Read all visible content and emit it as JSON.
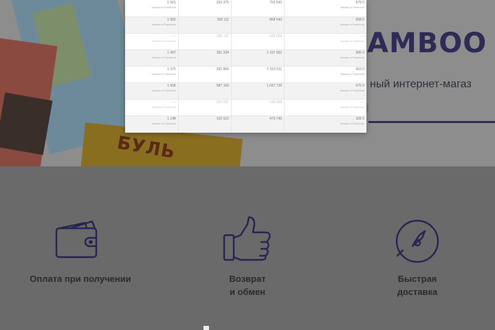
{
  "hero": {
    "brand": "AMBOO",
    "tagline": "ный интернет-магаз",
    "book_cover_text": "БУЛЬ"
  },
  "popup_table": {
    "rows": [
      {
        "c1": "1 561",
        "c1s": "Заказы в Facebook",
        "c2": "263 375",
        "c3": "753 642",
        "c4": "679 0",
        "c4s": "Заказы в Facebook",
        "faded": false
      },
      {
        "c1": "1 900",
        "c1s": "Заказы в Facebook",
        "c2": "358 111",
        "c3": "858 540",
        "c4": "658 0",
        "c4s": "Заказы в Facebook",
        "faded": false
      },
      {
        "c1": "—",
        "c1s": "Заказы в Facebook",
        "c2": "285 155",
        "c3": "588 056",
        "c4": "—",
        "c4s": "Заказы в Facebook",
        "faded": true
      },
      {
        "c1": "1 497",
        "c1s": "Заказы в Facebook",
        "c2": "391 234",
        "c3": "1 197 962",
        "c4": "589 0",
        "c4s": "Заказы в Facebook",
        "faded": false
      },
      {
        "c1": "1 375",
        "c1s": "Заказы в Facebook",
        "c2": "391 866",
        "c3": "1 019 511",
        "c4": "663 0",
        "c4s": "Заказы в Facebook",
        "faded": false
      },
      {
        "c1": "1 558",
        "c1s": "Заказы в Facebook",
        "c2": "587 160",
        "c3": "1 037 739",
        "c4": "675 0",
        "c4s": "Заказы в Facebook",
        "faded": false
      },
      {
        "c1": "—",
        "c1s": "Заказы в Facebook",
        "c2": "260 087",
        "c3": "548 088",
        "c4": "—",
        "c4s": "Заказы в Facebook",
        "faded": true
      },
      {
        "c1": "1 148",
        "c1s": "Заказы в Facebook",
        "c2": "192 022",
        "c3": "473 745",
        "c4": "328 0",
        "c4s": "Заказы в Facebook",
        "faded": false
      }
    ]
  },
  "features": [
    {
      "id": "payment",
      "label": "Оплата при получении",
      "icon": "wallet-icon"
    },
    {
      "id": "return",
      "label": "Возврат\nи обмен",
      "icon": "thumbs-up-icon"
    },
    {
      "id": "delivery",
      "label": "Быстрая\nдоставка",
      "icon": "compass-icon"
    }
  ],
  "colors": {
    "icon_stroke": "#262551",
    "brand": "#2e2c57",
    "overlay_bg": "#6a6a6a"
  }
}
